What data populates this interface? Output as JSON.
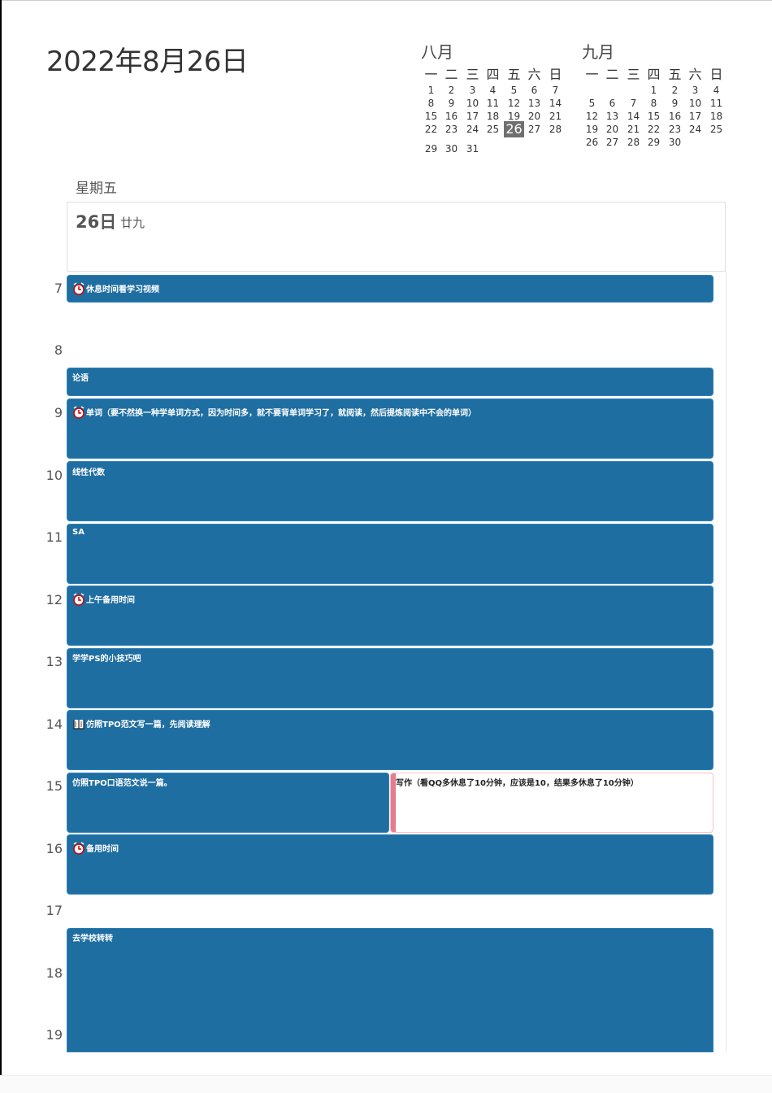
{
  "header": {
    "date": "2022年8月26日",
    "weekday": "星期五",
    "day_number": "26日",
    "lunar": "廿九"
  },
  "mini_calendars": {
    "weekday_headers": [
      "一",
      "二",
      "三",
      "四",
      "五",
      "六",
      "日"
    ],
    "august": {
      "title": "八月",
      "weeks": [
        [
          "1",
          "2",
          "3",
          "4",
          "5",
          "6",
          "7"
        ],
        [
          "8",
          "9",
          "10",
          "11",
          "12",
          "13",
          "14"
        ],
        [
          "15",
          "16",
          "17",
          "18",
          "19",
          "20",
          "21"
        ],
        [
          "22",
          "23",
          "24",
          "25",
          "26",
          "27",
          "28"
        ],
        [
          "29",
          "30",
          "31",
          "",
          "",
          "",
          ""
        ]
      ],
      "today": "26"
    },
    "september": {
      "title": "九月",
      "weeks": [
        [
          "",
          "",
          "",
          "1",
          "2",
          "3",
          "4"
        ],
        [
          "5",
          "6",
          "7",
          "8",
          "9",
          "10",
          "11"
        ],
        [
          "12",
          "13",
          "14",
          "15",
          "16",
          "17",
          "18"
        ],
        [
          "19",
          "20",
          "21",
          "22",
          "23",
          "24",
          "25"
        ],
        [
          "26",
          "27",
          "28",
          "29",
          "30",
          "",
          ""
        ]
      ]
    }
  },
  "hours": [
    "7",
    "8",
    "9",
    "10",
    "11",
    "12",
    "13",
    "14",
    "15",
    "16",
    "17",
    "18",
    "19"
  ],
  "events": [
    {
      "title": "休息时间看学习视频",
      "icon": "alarm-clock-icon"
    },
    {
      "title": "论语",
      "icon": ""
    },
    {
      "title": "单词（要不然换一种学单词方式，因为时间多，就不要背单词学习了，就阅读，然后提炼阅读中不会的单词）",
      "icon": "alarm-clock-icon"
    },
    {
      "title": "线性代数",
      "icon": ""
    },
    {
      "title": "SA",
      "icon": ""
    },
    {
      "title": "上午备用时间",
      "icon": "alarm-clock-icon"
    },
    {
      "title": "学学PS的小技巧吧",
      "icon": ""
    },
    {
      "title": "仿照TPO范文写一篇，先阅读理解",
      "icon": "book-icon"
    },
    {
      "title": "仿照TPO口语范文说一篇。",
      "icon": ""
    },
    {
      "title": "写作（看QQ多休息了10分钟，应该是10，结果多休息了10分钟）",
      "icon": ""
    },
    {
      "title": "备用时间",
      "icon": "alarm-clock-icon"
    },
    {
      "title": "去学校转转",
      "icon": ""
    }
  ],
  "colors": {
    "event_blue": "#1f6ea1",
    "event_pink_bar": "#e57d8d",
    "today_highlight": "#707070"
  }
}
